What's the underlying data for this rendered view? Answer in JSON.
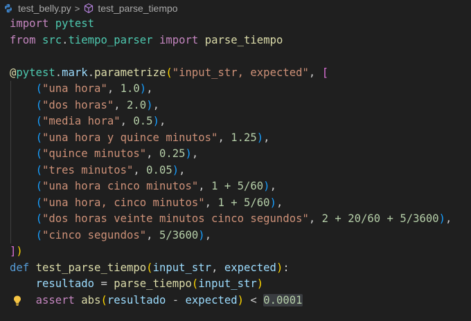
{
  "breadcrumb": {
    "file": "test_belly.py",
    "separator": ">",
    "symbol": "test_parse_tiempo"
  },
  "colors": {
    "background": "#1f1f1f",
    "keyword_import": "#c586c0",
    "keyword_def": "#569cd6",
    "module": "#4ec9b0",
    "function": "#dcdcaa",
    "variable": "#9cdcfe",
    "string": "#ce9178",
    "number": "#b5cea8",
    "bracket_level_1": "#ffd700",
    "bracket_level_2": "#da70d6",
    "bracket_level_3": "#179fff"
  },
  "icons": {
    "file": "python-file-icon",
    "symbol": "symbol-method-icon",
    "quick_fix": "lightbulb-icon"
  },
  "code": {
    "l1": {
      "kw": "import",
      "mod": "pytest"
    },
    "l2": {
      "kw_from": "from",
      "mod": "src",
      "dot": ".",
      "mod2": "tiempo_parser",
      "kw_import": "import",
      "fn": "parse_tiempo"
    },
    "l4": {
      "at": "@",
      "mod": "pytest",
      "dot1": ".",
      "var": "mark",
      "dot2": ".",
      "fn": "parametrize",
      "str": "\"input_str, expected\"",
      "comma": ", "
    },
    "cases": [
      {
        "str": "\"una hora\"",
        "rest": "1.0"
      },
      {
        "str": "\"dos horas\"",
        "rest": "2.0"
      },
      {
        "str": "\"media hora\"",
        "rest": "0.5"
      },
      {
        "str": "\"una hora y quince minutos\"",
        "rest": "1.25"
      },
      {
        "str": "\"quince minutos\"",
        "rest": "0.25"
      },
      {
        "str": "\"tres minutos\"",
        "rest": "0.05"
      },
      {
        "str": "\"una hora cinco minutos\"",
        "rest": "1 + 5/60"
      },
      {
        "str": "\"una hora, cinco minutos\"",
        "rest": "1 + 5/60"
      },
      {
        "str": "\"dos horas veinte minutos cinco segundos\"",
        "rest": "2 + 20/60 + 5/3600"
      },
      {
        "str": "\"cinco segundos\"",
        "rest": "5/3600"
      }
    ],
    "def_line": {
      "kw": "def",
      "fn": "test_parse_tiempo",
      "p1": "input_str",
      "p2": "expected"
    },
    "assign_line": {
      "var": "resultado",
      "op": " = ",
      "fn": "parse_tiempo",
      "arg": "input_str"
    },
    "assert_line": {
      "kw": "assert",
      "fn": "abs",
      "a": "resultado",
      "op": " - ",
      "b": "expected",
      "cmp": " < ",
      "num": "0.0001"
    }
  }
}
